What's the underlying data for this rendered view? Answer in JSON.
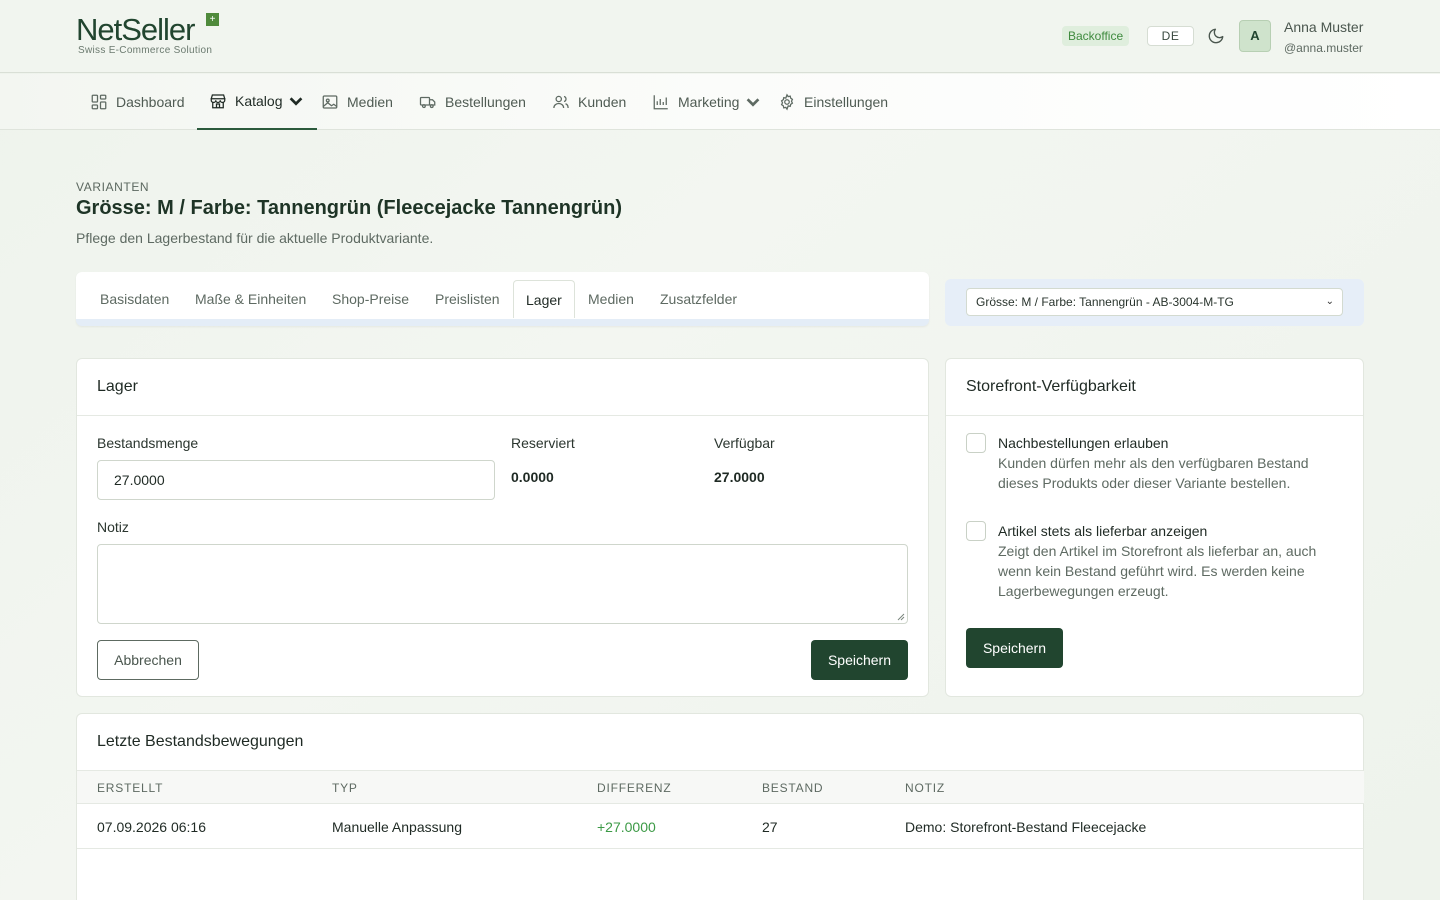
{
  "header": {
    "logo_text": "NetSeller",
    "logo_mark": "+",
    "logo_tagline": "Swiss E-Commerce Solution",
    "badge": "Backoffice",
    "language": "DE",
    "theme_icon": "moon-icon",
    "user": {
      "initial": "A",
      "name": "Anna Muster",
      "handle": "@anna.muster"
    }
  },
  "nav": {
    "items": [
      {
        "label": "Dashboard",
        "icon": "dashboard-icon"
      },
      {
        "label": "Katalog",
        "icon": "store-icon",
        "active": true,
        "dropdown": true
      },
      {
        "label": "Medien",
        "icon": "image-icon"
      },
      {
        "label": "Bestellungen",
        "icon": "truck-icon"
      },
      {
        "label": "Kunden",
        "icon": "users-icon"
      },
      {
        "label": "Marketing",
        "icon": "chart-icon",
        "dropdown": true
      },
      {
        "label": "Einstellungen",
        "icon": "gear-icon"
      }
    ]
  },
  "page": {
    "eyebrow": "VARIANTEN",
    "title": "Grösse: M / Farbe: Tannengrün (Fleecejacke Tannengrün)",
    "subtitle": "Pflege den Lagerbestand für die aktuelle Produktvariante."
  },
  "tabs": [
    "Basisdaten",
    "Maße & Einheiten",
    "Shop-Preise",
    "Preislisten",
    "Lager",
    "Medien",
    "Zusatzfelder"
  ],
  "active_tab": "Lager",
  "variant_select": {
    "value": "Grösse: M / Farbe: Tannengrün - AB-3004-M-TG"
  },
  "stock": {
    "title": "Lager",
    "quantity_label": "Bestandsmenge",
    "quantity_value": "27.0000",
    "reserved_label": "Reserviert",
    "reserved_value": "0.0000",
    "available_label": "Verfügbar",
    "available_value": "27.0000",
    "note_label": "Notiz",
    "note_value": "",
    "cancel_label": "Abbrechen",
    "save_label": "Speichern"
  },
  "storefront": {
    "title": "Storefront-Verfügbarkeit",
    "option1_title": "Nachbestellungen erlauben",
    "option1_desc": "Kunden dürfen mehr als den verfügbaren Bestand dieses Produkts oder dieser Variante bestellen.",
    "option1_checked": false,
    "option2_title": "Artikel stets als lieferbar anzeigen",
    "option2_desc": "Zeigt den Artikel im Storefront als lieferbar an, auch wenn kein Bestand geführt wird. Es werden keine Lagerbewegungen erzeugt.",
    "option2_checked": false,
    "save_label": "Speichern"
  },
  "movements": {
    "title": "Letzte Bestandsbewegungen",
    "columns": [
      "ERSTELLT",
      "TYP",
      "DIFFERENZ",
      "BESTAND",
      "NOTIZ"
    ],
    "rows": [
      [
        "07.09.2026 06:16",
        "Manuelle Anpassung",
        "+27.0000",
        "27",
        "Demo: Storefront-Bestand Fleecejacke"
      ]
    ]
  },
  "colors": {
    "brand": "#21452f",
    "positive": "#3c9a46",
    "badge_bg": "#dfeedd"
  }
}
